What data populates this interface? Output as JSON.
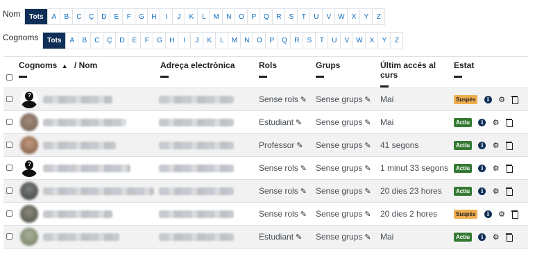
{
  "filters": {
    "first_name": {
      "label": "Nom",
      "options": [
        "Tots",
        "A",
        "B",
        "C",
        "Ç",
        "D",
        "E",
        "F",
        "G",
        "H",
        "I",
        "J",
        "K",
        "L",
        "M",
        "N",
        "O",
        "P",
        "Q",
        "R",
        "S",
        "T",
        "U",
        "V",
        "W",
        "X",
        "Y",
        "Z"
      ],
      "selected": "Tots"
    },
    "last_name": {
      "label": "Cognoms",
      "options": [
        "Tots",
        "A",
        "B",
        "C",
        "Ç",
        "D",
        "E",
        "F",
        "G",
        "H",
        "I",
        "J",
        "K",
        "L",
        "M",
        "N",
        "O",
        "P",
        "Q",
        "R",
        "S",
        "T",
        "U",
        "V",
        "W",
        "X",
        "Y",
        "Z"
      ],
      "selected": "Tots"
    }
  },
  "table": {
    "headers": {
      "name_part1": "Cognoms",
      "sort_icon": "caret-up-icon",
      "name_part2": "/ Nom",
      "email": "Adreça electrònica",
      "roles": "Rols",
      "groups": "Grups",
      "last_access": "Últim accés al curs",
      "status": "Estat"
    },
    "rows": [
      {
        "avatar": "anon",
        "roles": "Sense rols",
        "groups": "Sense grups",
        "last_access": "Mai",
        "status": "Suspès",
        "status_type": "suspended"
      },
      {
        "avatar": "photo1",
        "roles": "Estudiant",
        "groups": "Sense grups",
        "last_access": "Mai",
        "status": "Actiu",
        "status_type": "active"
      },
      {
        "avatar": "photo2",
        "roles": "Professor",
        "groups": "Sense grups",
        "last_access": "41 segons",
        "status": "Actiu",
        "status_type": "active"
      },
      {
        "avatar": "anon",
        "roles": "Sense rols",
        "groups": "Sense grups",
        "last_access": "1 minut 33 segons",
        "status": "Actiu",
        "status_type": "active"
      },
      {
        "avatar": "photo3",
        "roles": "Sense rols",
        "groups": "Sense grups",
        "last_access": "20 dies 23 hores",
        "status": "Actiu",
        "status_type": "active"
      },
      {
        "avatar": "photo4",
        "roles": "Sense rols",
        "groups": "Sense grups",
        "last_access": "20 dies 2 hores",
        "status": "Suspès",
        "status_type": "suspended"
      },
      {
        "avatar": "photo5",
        "roles": "Estudiant",
        "groups": "Sense grups",
        "last_access": "Mai",
        "status": "Actiu",
        "status_type": "active"
      }
    ]
  },
  "icons": {
    "edit": "pencil-icon",
    "info": "info-icon",
    "settings": "gear-icon",
    "delete": "trash-icon"
  },
  "colors": {
    "active_letter_bg": "#0f2f56",
    "link": "#0f6cbf",
    "badge_active": "#357a32",
    "badge_suspended": "#f0ad4e"
  }
}
